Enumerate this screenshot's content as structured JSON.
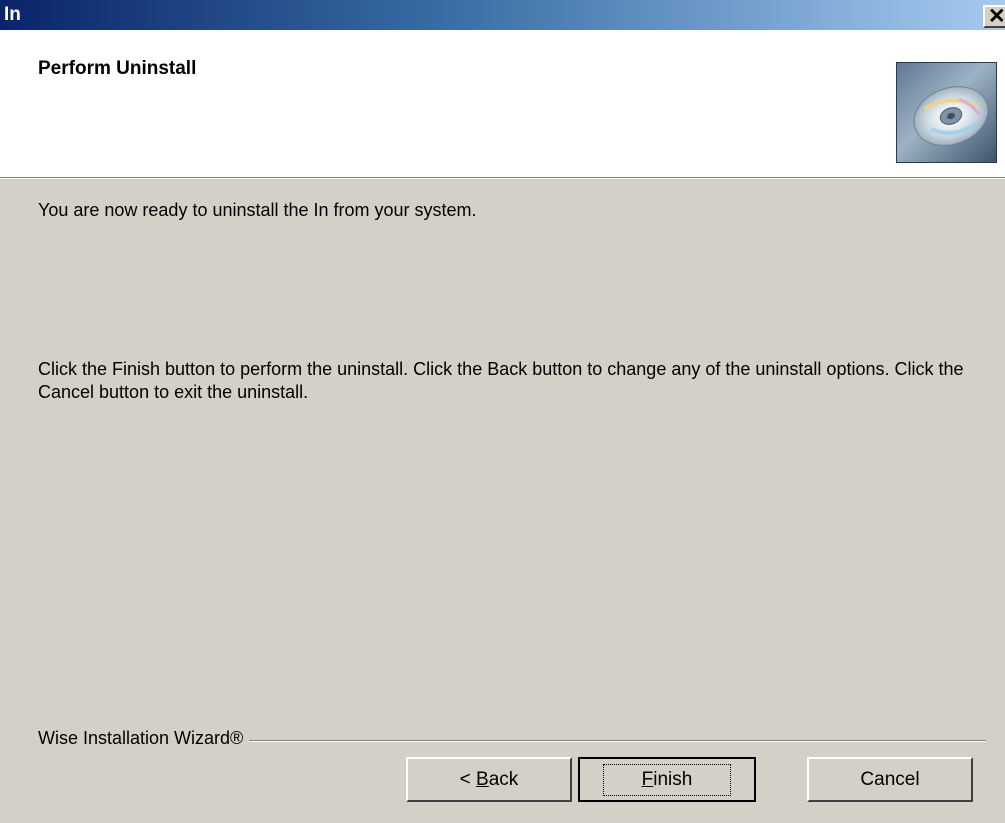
{
  "window": {
    "title": "In",
    "close_glyph": "✕"
  },
  "header": {
    "title": "Perform Uninstall",
    "image_icon": "cd-icon"
  },
  "body": {
    "ready_message": "You are now ready to uninstall the In from your system.",
    "instructions": "Click the Finish button to perform the uninstall. Click the Back button to change any of the uninstall options. Click the Cancel button to exit the uninstall."
  },
  "footer": {
    "group_label": "Wise Installation Wizard®",
    "back_prefix": "< ",
    "back_mnemonic": "B",
    "back_rest": "ack",
    "finish_mnemonic": "F",
    "finish_rest": "inish",
    "cancel_label": "Cancel"
  },
  "colors": {
    "title_bar_start": "#0a246a",
    "title_bar_end": "#a6caf0",
    "dialog_face": "#d4d0c8",
    "header_background": "#ffffff"
  }
}
